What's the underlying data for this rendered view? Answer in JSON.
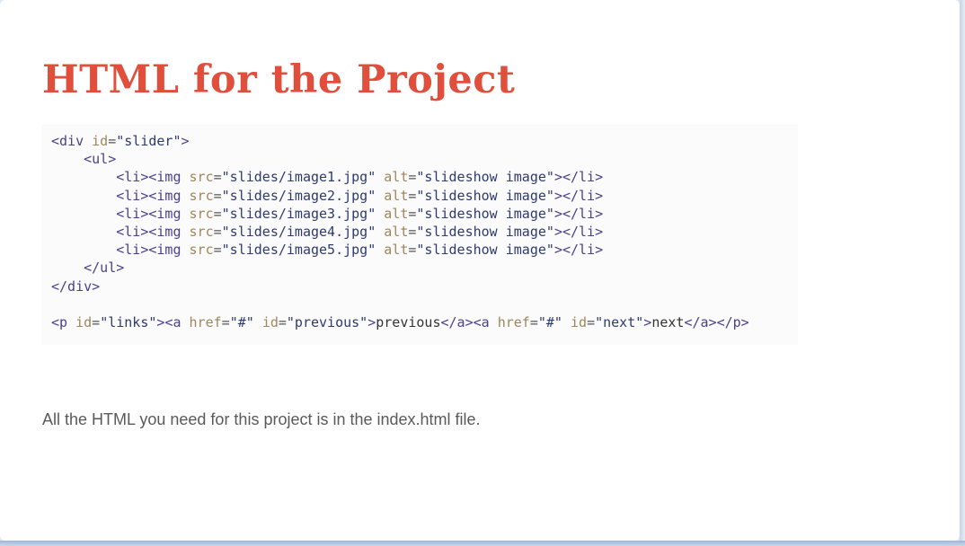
{
  "slide": {
    "title": "HTML for the Project",
    "code_lines": [
      "<div id=\"slider\">",
      "    <ul>",
      "        <li><img src=\"slides/image1.jpg\" alt=\"slideshow image\"></li>",
      "        <li><img src=\"slides/image2.jpg\" alt=\"slideshow image\"></li>",
      "        <li><img src=\"slides/image3.jpg\" alt=\"slideshow image\"></li>",
      "        <li><img src=\"slides/image4.jpg\" alt=\"slideshow image\"></li>",
      "        <li><img src=\"slides/image5.jpg\" alt=\"slideshow image\"></li>",
      "    </ul>",
      "</div>",
      "",
      "<p id=\"links\"><a href=\"#\" id=\"previous\">previous</a><a href=\"#\" id=\"next\">next</a></p>"
    ],
    "caption": "All the HTML you need for this project is in the index.html file."
  },
  "colors": {
    "title": "#e04e3c",
    "code_background": "#fcfbfb",
    "tag": "#4b3f8c",
    "attribute": "#a0855a",
    "string": "#2d3a6e",
    "caption": "#5a5a5a"
  }
}
